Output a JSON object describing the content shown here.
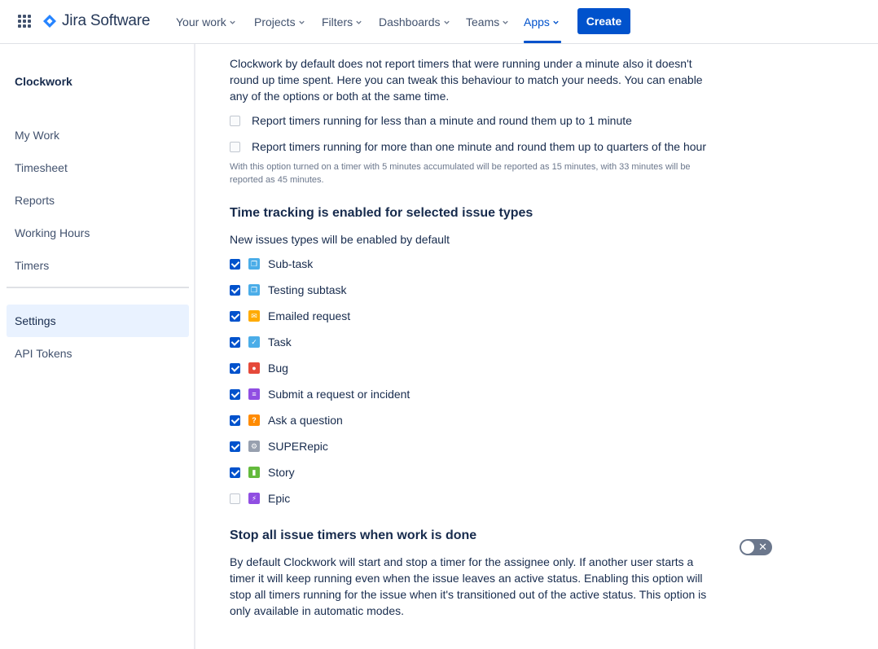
{
  "app": {
    "name": "Jira Software"
  },
  "nav": {
    "items": [
      {
        "label": "Your work"
      },
      {
        "label": "Projects"
      },
      {
        "label": "Filters"
      },
      {
        "label": "Dashboards"
      },
      {
        "label": "Teams"
      },
      {
        "label": "Apps"
      }
    ],
    "active": "Apps",
    "create_label": "Create"
  },
  "sidebar": {
    "title": "Clockwork",
    "items": [
      {
        "label": "My Work"
      },
      {
        "label": "Timesheet"
      },
      {
        "label": "Reports"
      },
      {
        "label": "Working Hours"
      },
      {
        "label": "Timers"
      },
      {
        "label": "Settings"
      },
      {
        "label": "API Tokens"
      }
    ],
    "selected": "Settings"
  },
  "rounding": {
    "description": "Clockwork by default does not report timers that were running under a minute also it doesn't round up time spent. Here you can tweak this behaviour to match your needs. You can enable any of the options or both at the same time.",
    "options": [
      {
        "label": "Report timers running for less than a minute and round them up to 1 minute",
        "checked": false
      },
      {
        "label": "Report timers running for more than one minute and round them up to quarters of the hour",
        "checked": false
      }
    ],
    "hint": "With this option turned on a timer with 5 minutes accumulated will be reported as 15 minutes, with 33 minutes will be reported as 45 minutes."
  },
  "issue_types": {
    "title": "Time tracking is enabled for selected issue types",
    "subtitle": "New issues types will be enabled by default",
    "items": [
      {
        "label": "Sub-task",
        "checked": true,
        "icon": "subtask-icon",
        "color": "#4bade8"
      },
      {
        "label": "Testing subtask",
        "checked": true,
        "icon": "subtask-icon",
        "color": "#4bade8"
      },
      {
        "label": "Emailed request",
        "checked": true,
        "icon": "email-icon",
        "color": "#ffab00"
      },
      {
        "label": "Task",
        "checked": true,
        "icon": "task-icon",
        "color": "#4bade8"
      },
      {
        "label": "Bug",
        "checked": true,
        "icon": "bug-icon",
        "color": "#e5493a"
      },
      {
        "label": "Submit a request or incident",
        "checked": true,
        "icon": "request-icon",
        "color": "#904ee2"
      },
      {
        "label": "Ask a question",
        "checked": true,
        "icon": "question-icon",
        "color": "#ff8b00"
      },
      {
        "label": "SUPERepic",
        "checked": true,
        "icon": "gear-icon",
        "color": "#97a0af"
      },
      {
        "label": "Story",
        "checked": true,
        "icon": "story-icon",
        "color": "#63ba3c"
      },
      {
        "label": "Epic",
        "checked": false,
        "icon": "epic-icon",
        "color": "#904ee2"
      }
    ]
  },
  "stop_timers": {
    "title": "Stop all issue timers when work is done",
    "description": "By default Clockwork will start and stop a timer for the assignee only. If another user starts a timer it will keep running even when the issue leaves an active status. Enabling this option will stop all timers running for the issue when it's transitioned out of the active status. This option is only available in automatic modes.",
    "enabled": false
  },
  "colors": {
    "accent": "#0052cc",
    "selected_bg": "#e9f2ff"
  }
}
